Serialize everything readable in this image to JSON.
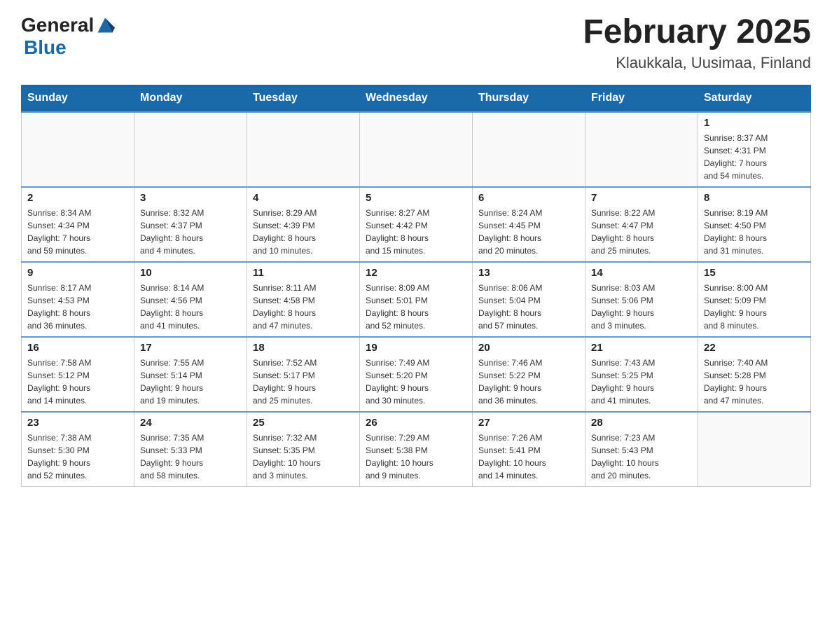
{
  "header": {
    "logo_general": "General",
    "logo_blue": "Blue",
    "month_title": "February 2025",
    "location": "Klaukkala, Uusimaa, Finland"
  },
  "days_of_week": [
    "Sunday",
    "Monday",
    "Tuesday",
    "Wednesday",
    "Thursday",
    "Friday",
    "Saturday"
  ],
  "weeks": [
    [
      {
        "day": "",
        "info": ""
      },
      {
        "day": "",
        "info": ""
      },
      {
        "day": "",
        "info": ""
      },
      {
        "day": "",
        "info": ""
      },
      {
        "day": "",
        "info": ""
      },
      {
        "day": "",
        "info": ""
      },
      {
        "day": "1",
        "info": "Sunrise: 8:37 AM\nSunset: 4:31 PM\nDaylight: 7 hours\nand 54 minutes."
      }
    ],
    [
      {
        "day": "2",
        "info": "Sunrise: 8:34 AM\nSunset: 4:34 PM\nDaylight: 7 hours\nand 59 minutes."
      },
      {
        "day": "3",
        "info": "Sunrise: 8:32 AM\nSunset: 4:37 PM\nDaylight: 8 hours\nand 4 minutes."
      },
      {
        "day": "4",
        "info": "Sunrise: 8:29 AM\nSunset: 4:39 PM\nDaylight: 8 hours\nand 10 minutes."
      },
      {
        "day": "5",
        "info": "Sunrise: 8:27 AM\nSunset: 4:42 PM\nDaylight: 8 hours\nand 15 minutes."
      },
      {
        "day": "6",
        "info": "Sunrise: 8:24 AM\nSunset: 4:45 PM\nDaylight: 8 hours\nand 20 minutes."
      },
      {
        "day": "7",
        "info": "Sunrise: 8:22 AM\nSunset: 4:47 PM\nDaylight: 8 hours\nand 25 minutes."
      },
      {
        "day": "8",
        "info": "Sunrise: 8:19 AM\nSunset: 4:50 PM\nDaylight: 8 hours\nand 31 minutes."
      }
    ],
    [
      {
        "day": "9",
        "info": "Sunrise: 8:17 AM\nSunset: 4:53 PM\nDaylight: 8 hours\nand 36 minutes."
      },
      {
        "day": "10",
        "info": "Sunrise: 8:14 AM\nSunset: 4:56 PM\nDaylight: 8 hours\nand 41 minutes."
      },
      {
        "day": "11",
        "info": "Sunrise: 8:11 AM\nSunset: 4:58 PM\nDaylight: 8 hours\nand 47 minutes."
      },
      {
        "day": "12",
        "info": "Sunrise: 8:09 AM\nSunset: 5:01 PM\nDaylight: 8 hours\nand 52 minutes."
      },
      {
        "day": "13",
        "info": "Sunrise: 8:06 AM\nSunset: 5:04 PM\nDaylight: 8 hours\nand 57 minutes."
      },
      {
        "day": "14",
        "info": "Sunrise: 8:03 AM\nSunset: 5:06 PM\nDaylight: 9 hours\nand 3 minutes."
      },
      {
        "day": "15",
        "info": "Sunrise: 8:00 AM\nSunset: 5:09 PM\nDaylight: 9 hours\nand 8 minutes."
      }
    ],
    [
      {
        "day": "16",
        "info": "Sunrise: 7:58 AM\nSunset: 5:12 PM\nDaylight: 9 hours\nand 14 minutes."
      },
      {
        "day": "17",
        "info": "Sunrise: 7:55 AM\nSunset: 5:14 PM\nDaylight: 9 hours\nand 19 minutes."
      },
      {
        "day": "18",
        "info": "Sunrise: 7:52 AM\nSunset: 5:17 PM\nDaylight: 9 hours\nand 25 minutes."
      },
      {
        "day": "19",
        "info": "Sunrise: 7:49 AM\nSunset: 5:20 PM\nDaylight: 9 hours\nand 30 minutes."
      },
      {
        "day": "20",
        "info": "Sunrise: 7:46 AM\nSunset: 5:22 PM\nDaylight: 9 hours\nand 36 minutes."
      },
      {
        "day": "21",
        "info": "Sunrise: 7:43 AM\nSunset: 5:25 PM\nDaylight: 9 hours\nand 41 minutes."
      },
      {
        "day": "22",
        "info": "Sunrise: 7:40 AM\nSunset: 5:28 PM\nDaylight: 9 hours\nand 47 minutes."
      }
    ],
    [
      {
        "day": "23",
        "info": "Sunrise: 7:38 AM\nSunset: 5:30 PM\nDaylight: 9 hours\nand 52 minutes."
      },
      {
        "day": "24",
        "info": "Sunrise: 7:35 AM\nSunset: 5:33 PM\nDaylight: 9 hours\nand 58 minutes."
      },
      {
        "day": "25",
        "info": "Sunrise: 7:32 AM\nSunset: 5:35 PM\nDaylight: 10 hours\nand 3 minutes."
      },
      {
        "day": "26",
        "info": "Sunrise: 7:29 AM\nSunset: 5:38 PM\nDaylight: 10 hours\nand 9 minutes."
      },
      {
        "day": "27",
        "info": "Sunrise: 7:26 AM\nSunset: 5:41 PM\nDaylight: 10 hours\nand 14 minutes."
      },
      {
        "day": "28",
        "info": "Sunrise: 7:23 AM\nSunset: 5:43 PM\nDaylight: 10 hours\nand 20 minutes."
      },
      {
        "day": "",
        "info": ""
      }
    ]
  ]
}
